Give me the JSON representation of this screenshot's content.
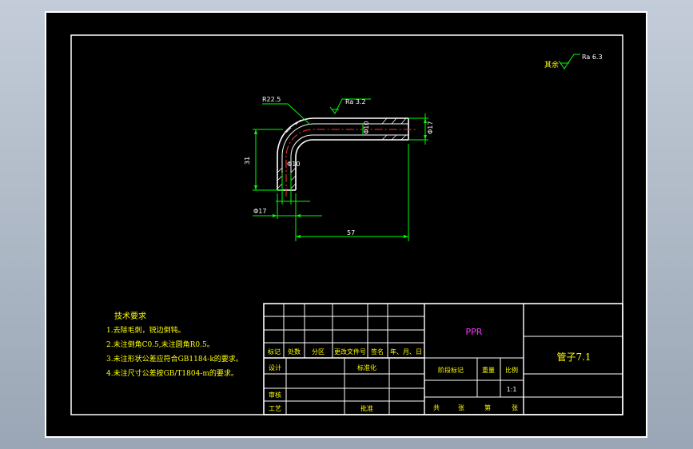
{
  "finish_note": {
    "prefix": "其余",
    "roughness": "Ra 6.3"
  },
  "part_dims": {
    "bend_radius": "R22.5",
    "surface_roughness": "Ra 3.2",
    "inner_diameter_horizontal": "Φ10",
    "outer_diameter_horizontal": "Φ17",
    "inner_diameter_vertical": "Φ10",
    "outer_diameter_vertical": "Φ17",
    "height": "31",
    "length": "57"
  },
  "tech_req": {
    "title": "技术要求",
    "items": [
      "1.去除毛刺，锐边倒钝。",
      "2.未注倒角C0.5,未注圆角R0.5。",
      "3.未注形状公差应符合GB1184-k的要求。",
      "4.未注尺寸公差按GB/T1804-m的要求。"
    ]
  },
  "title_block": {
    "material": "PPR",
    "part_name": "管子7.1",
    "rev_headers": [
      "标记",
      "处数",
      "分区",
      "更改文件号",
      "签名",
      "年、月、日"
    ],
    "design": "设计",
    "standardize": "标准化",
    "review": "审核",
    "process": "工艺",
    "approve": "批准",
    "stage_mark": "阶段标记",
    "weight": "重量",
    "scale_label": "比例",
    "scale_value": "1:1",
    "sheets_total": "共",
    "sheets_unit": "张",
    "sheet_num": "第",
    "sheet_unit": "张"
  }
}
